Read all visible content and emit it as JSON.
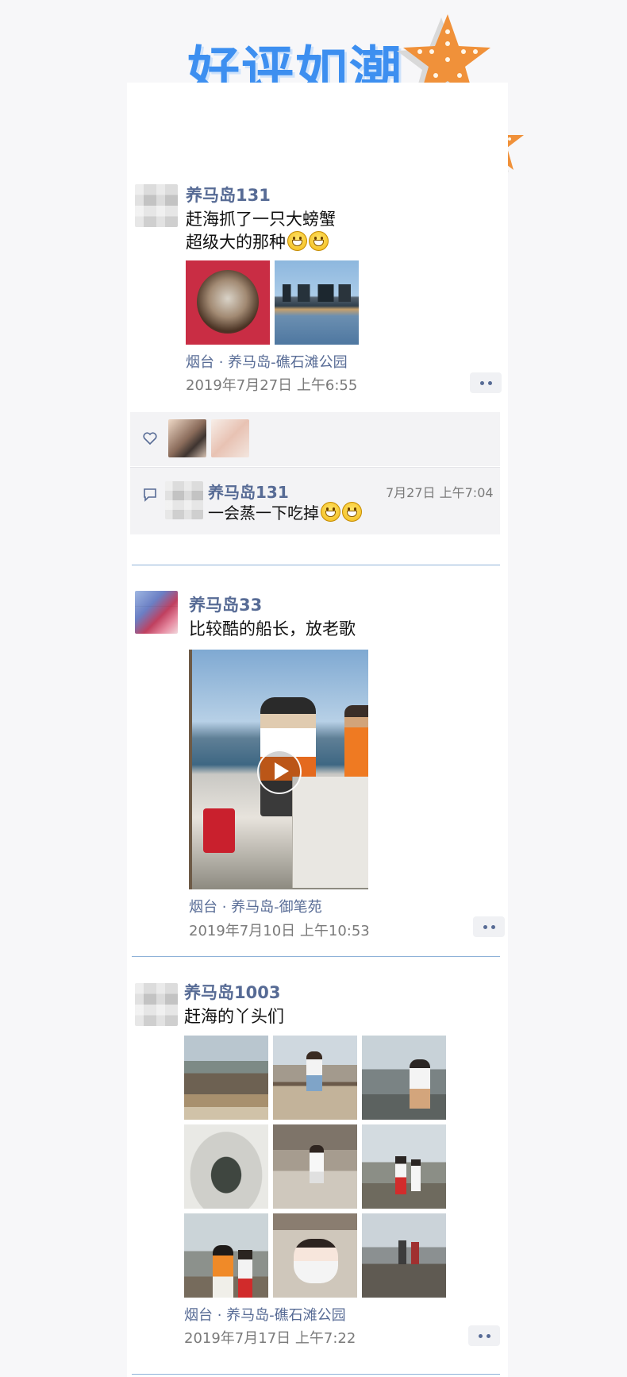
{
  "header": {
    "title": "好评如潮"
  },
  "posts": [
    {
      "username": "养马岛131",
      "text_line1": "赶海抓了一只大螃蟹",
      "text_line2": "超级大的那种",
      "location": "烟台 · 养马岛-礁石滩公园",
      "timestamp": "2019年7月27日 上午6:55",
      "comment": {
        "username": "养马岛131",
        "text": "一会蒸一下吃掉",
        "timestamp": "7月27日 上午7:04"
      }
    },
    {
      "username": "养马岛33",
      "text": "比较酷的船长，放老歌",
      "location": "烟台 · 养马岛-御笔苑",
      "timestamp": "2019年7月10日 上午10:53"
    },
    {
      "username": "养马岛1003",
      "text": "赶海的丫头们",
      "location": "烟台 · 养马岛-礁石滩公园",
      "timestamp": "2019年7月17日 上午7:22"
    }
  ],
  "icons": {
    "like": "heart-icon",
    "comment": "comment-icon",
    "more": "more-dots-icon",
    "play": "play-icon"
  },
  "colors": {
    "username": "#576b95",
    "header_title": "#3d8ff0",
    "starfish": "#f0913a"
  }
}
